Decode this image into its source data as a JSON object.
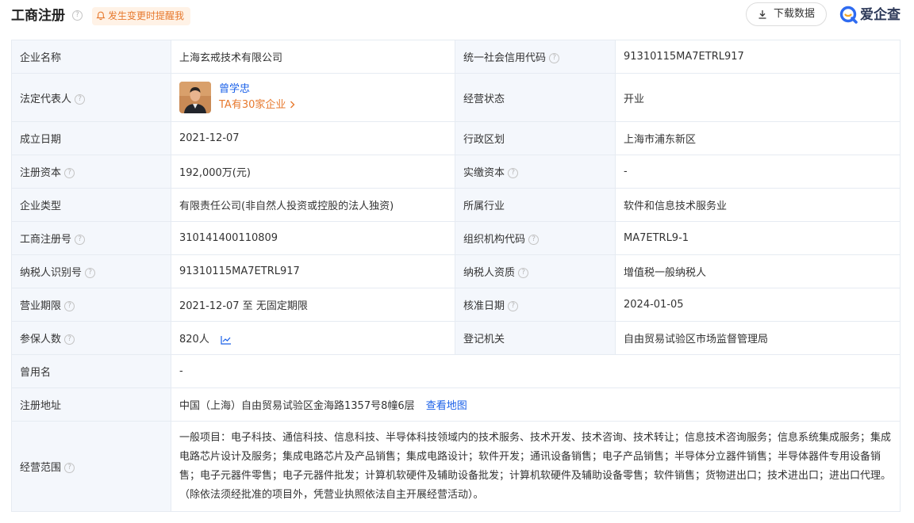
{
  "header": {
    "title": "工商注册",
    "remind_label": "发生变更时提醒我",
    "download_label": "下载数据",
    "brand_name": "爱企查"
  },
  "icons": {
    "help": "question-circle-icon",
    "bell": "bell-icon",
    "download": "download-icon",
    "trend": "line-chart-icon",
    "chevron": "chevron-right-icon"
  },
  "colors": {
    "accent": "#1a60e8",
    "orange": "#e7792e",
    "label_bg": "#f4f7fc",
    "border": "#e6ebf2"
  },
  "info": {
    "company_name_label": "企业名称",
    "company_name": "上海玄戒技术有限公司",
    "credit_code_label": "统一社会信用代码",
    "credit_code": "91310115MA7ETRL917",
    "legal_rep_label": "法定代表人",
    "legal_rep_name": "曾学忠",
    "legal_rep_companies": "TA有30家企业",
    "status_label": "经营状态",
    "status": "开业",
    "founded_label": "成立日期",
    "founded": "2021-12-07",
    "region_label": "行政区划",
    "region": "上海市浦东新区",
    "reg_capital_label": "注册资本",
    "reg_capital": "192,000万(元)",
    "paid_capital_label": "实缴资本",
    "paid_capital": "-",
    "type_label": "企业类型",
    "type": "有限责任公司(非自然人投资或控股的法人独资)",
    "industry_label": "所属行业",
    "industry": "软件和信息技术服务业",
    "reg_no_label": "工商注册号",
    "reg_no": "310141400110809",
    "org_code_label": "组织机构代码",
    "org_code": "MA7ETRL9-1",
    "taxpayer_id_label": "纳税人识别号",
    "taxpayer_id": "91310115MA7ETRL917",
    "taxpayer_qual_label": "纳税人资质",
    "taxpayer_qual": "增值税一般纳税人",
    "term_label": "营业期限",
    "term": "2021-12-07 至 无固定期限",
    "approval_date_label": "核准日期",
    "approval_date": "2024-01-05",
    "insured_label": "参保人数",
    "insured": "820人",
    "authority_label": "登记机关",
    "authority": "自由贸易试验区市场监督管理局",
    "former_name_label": "曾用名",
    "former_name": "-",
    "address_label": "注册地址",
    "address": "中国（上海）自由贸易试验区金海路1357号8幢6层",
    "map_link": "查看地图",
    "scope_label": "经营范围",
    "scope": "一般项目：电子科技、通信科技、信息科技、半导体科技领域内的技术服务、技术开发、技术咨询、技术转让；信息技术咨询服务；信息系统集成服务；集成电路芯片设计及服务；集成电路芯片及产品销售；集成电路设计；软件开发；通讯设备销售；电子产品销售；半导体分立器件销售；半导体器件专用设备销售；电子元器件零售；电子元器件批发；计算机软硬件及辅助设备批发；计算机软硬件及辅助设备零售；软件销售；货物进出口；技术进出口；进出口代理。（除依法须经批准的项目外，凭营业执照依法自主开展经营活动）。"
  }
}
